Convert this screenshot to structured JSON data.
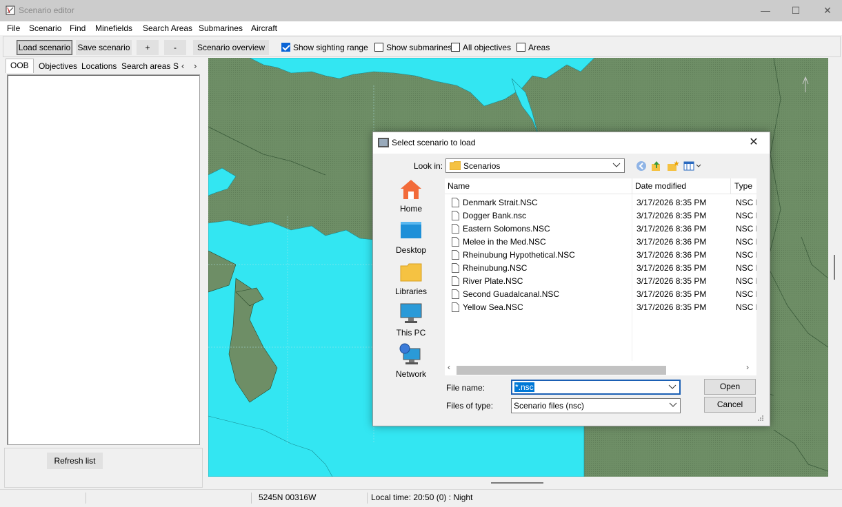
{
  "window": {
    "title": "Scenario editor",
    "minimize": "—",
    "maximize": "☐",
    "close": "✕"
  },
  "menu": [
    "File",
    "Scenario",
    "Find",
    "Minefields",
    "Search Areas",
    "Submarines",
    "Aircraft"
  ],
  "toolbar": {
    "load": "Load scenario",
    "save": "Save scenario",
    "zoom_in": "+",
    "zoom_out": "-",
    "overview": "Scenario overview",
    "show_sighting": {
      "label": "Show sighting range",
      "checked": true
    },
    "show_subs": {
      "label": "Show submarines",
      "checked": false
    },
    "all_objectives": {
      "label": "All objectives",
      "checked": false
    },
    "areas": {
      "label": "Areas",
      "checked": false
    }
  },
  "left_panel": {
    "tabs": [
      "OOB",
      "Objectives",
      "Locations",
      "Search areas",
      "S"
    ],
    "active_tab": "OOB",
    "refresh": "Refresh list"
  },
  "status": {
    "coords": "5245N 00316W",
    "local_time": "Local time: 20:50 (0) : Night"
  },
  "dialog": {
    "title": "Select scenario to load",
    "close": "✕",
    "look_in_label": "Look in:",
    "look_in_value": "Scenarios",
    "places": [
      {
        "label": "Home",
        "icon": "home-icon"
      },
      {
        "label": "Desktop",
        "icon": "desktop-icon"
      },
      {
        "label": "Libraries",
        "icon": "libraries-icon"
      },
      {
        "label": "This PC",
        "icon": "this-pc-icon"
      },
      {
        "label": "Network",
        "icon": "network-icon"
      }
    ],
    "columns": {
      "name": "Name",
      "date": "Date modified",
      "type": "Type"
    },
    "files": [
      {
        "name": "Denmark Strait.NSC",
        "date": "3/17/2026 8:35 PM",
        "type": "NSC F"
      },
      {
        "name": "Dogger Bank.nsc",
        "date": "3/17/2026 8:35 PM",
        "type": "NSC F"
      },
      {
        "name": "Eastern Solomons.NSC",
        "date": "3/17/2026 8:36 PM",
        "type": "NSC F"
      },
      {
        "name": "Melee in the Med.NSC",
        "date": "3/17/2026 8:36 PM",
        "type": "NSC F"
      },
      {
        "name": "Rheinubung Hypothetical.NSC",
        "date": "3/17/2026 8:36 PM",
        "type": "NSC F"
      },
      {
        "name": "Rheinubung.NSC",
        "date": "3/17/2026 8:35 PM",
        "type": "NSC F"
      },
      {
        "name": "River Plate.NSC",
        "date": "3/17/2026 8:35 PM",
        "type": "NSC F"
      },
      {
        "name": "Second Guadalcanal.NSC",
        "date": "3/17/2026 8:35 PM",
        "type": "NSC F"
      },
      {
        "name": "Yellow Sea.NSC",
        "date": "3/17/2026 8:35 PM",
        "type": "NSC F"
      }
    ],
    "file_name_label": "File name:",
    "file_name_value": "*.nsc",
    "file_type_label": "Files of type:",
    "file_type_value": "Scenario files (nsc)",
    "open": "Open",
    "cancel": "Cancel"
  },
  "colors": {
    "land": "#6a8a63",
    "sea": "#33e6f2",
    "accent": "#0078d7"
  }
}
